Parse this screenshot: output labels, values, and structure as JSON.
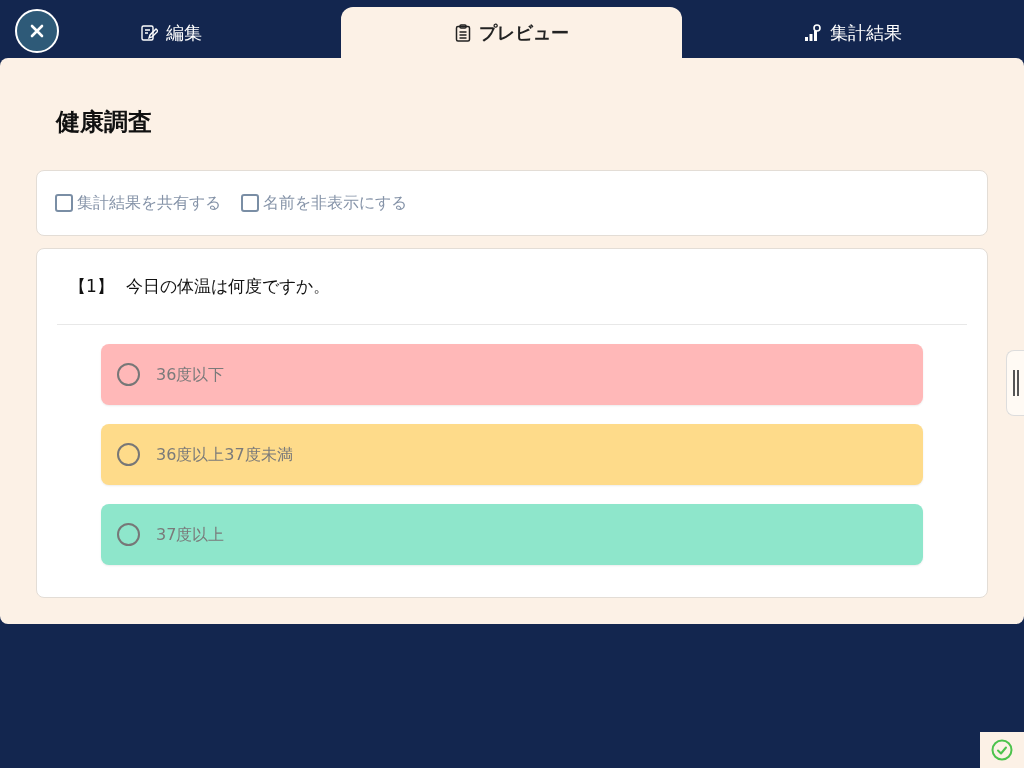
{
  "tabs": [
    {
      "label": "編集",
      "kind": "edit",
      "selected": false
    },
    {
      "label": "プレビュー",
      "kind": "preview",
      "selected": true
    },
    {
      "label": "集計結果",
      "kind": "results",
      "selected": false
    }
  ],
  "survey": {
    "title": "健康調査",
    "settings": [
      {
        "label": "集計結果を共有する",
        "checked": false
      },
      {
        "label": "名前を非表示にする",
        "checked": false
      }
    ],
    "question": {
      "number": "【1】",
      "text": "今日の体温は何度ですか。",
      "options": [
        {
          "label": "36度以下",
          "color": "#ffb8b8",
          "selected": false
        },
        {
          "label": "36度以上37度未満",
          "color": "#fedb8a",
          "selected": false
        },
        {
          "label": "37度以上",
          "color": "#8ee6cb",
          "selected": false
        }
      ]
    }
  }
}
